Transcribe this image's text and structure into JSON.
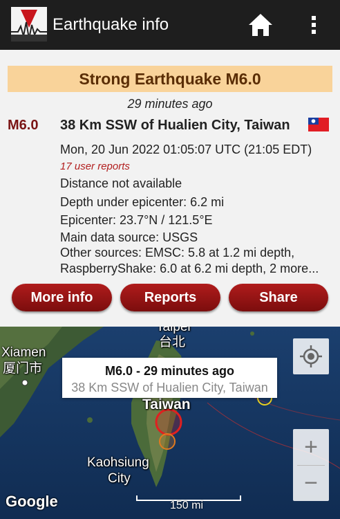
{
  "app": {
    "title": "Earthquake info",
    "logo_letter": "V",
    "icons": {
      "logo": "seismograph-logo-icon",
      "home": "home-icon",
      "menu": "more-vert-icon"
    }
  },
  "event": {
    "headline": "Strong Earthquake M6.0",
    "time_ago": "29 minutes ago",
    "magnitude": "M6.0",
    "place": "38 Km SSW of Hualien City, Taiwan",
    "flag": "taiwan-flag-icon",
    "datetime": "Mon, 20 Jun 2022 01:05:07 UTC (21:05 EDT)",
    "user_reports": "17 user reports",
    "distance": "Distance not available",
    "depth": "Depth under epicenter: 6.2 mi",
    "epicenter": "Epicenter: 23.7°N / 121.5°E",
    "main_source": "Main data source: USGS",
    "other_sources_1": "Other sources: EMSC: 5.8 at 1.2 mi depth,",
    "other_sources_2": "RaspberryShake: 6.0 at 6.2 mi depth, 2 more..."
  },
  "buttons": {
    "more_info": "More info",
    "reports": "Reports",
    "share": "Share"
  },
  "map": {
    "labels": {
      "taipei_en": "Taipei",
      "taipei_zh": "台北",
      "xiamen_en": "Xiamen",
      "xiamen_zh": "厦门市",
      "taiwan": "Taiwan",
      "kaohsiung_1": "Kaohsiung",
      "kaohsiung_2": "City"
    },
    "callout_title": "M6.0  -  29 minutes ago",
    "callout_subtitle": "38 Km SSW of Hualien City, Taiwan",
    "zoom_in": "+",
    "zoom_out": "−",
    "attribution": "Google",
    "scale": "150 mi",
    "colors": {
      "marker_main": "#e02020",
      "marker_secondary": "#e07a20",
      "marker_other": "#e8d020"
    }
  }
}
